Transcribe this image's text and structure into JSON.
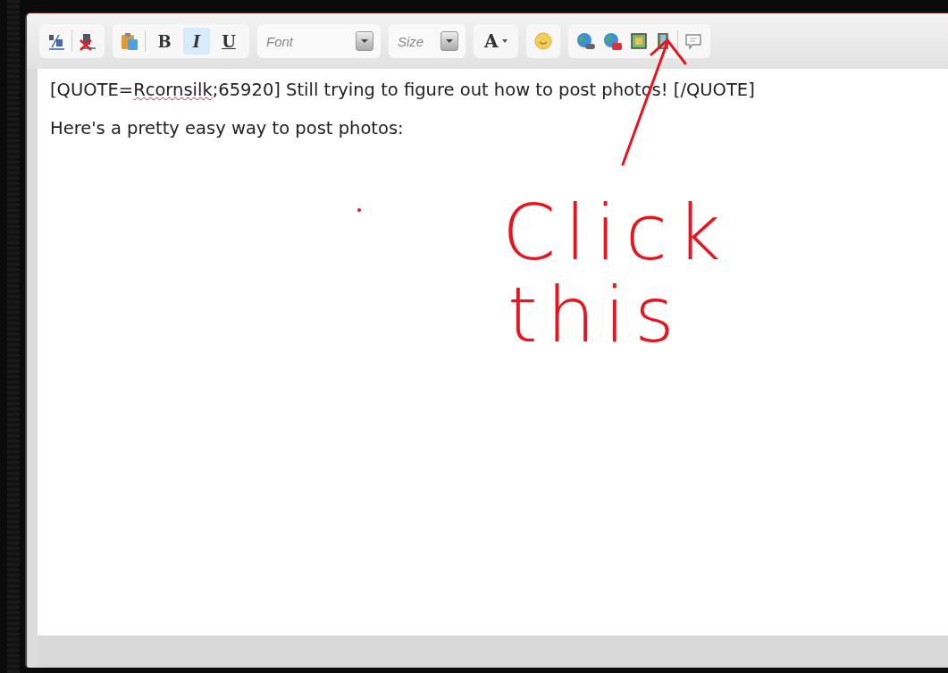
{
  "toolbar": {
    "format_buttons": [
      {
        "label": "B",
        "selected": false
      },
      {
        "label": "I",
        "selected": true
      },
      {
        "label": "U",
        "selected": false
      }
    ],
    "font_select": {
      "placeholder": "Font"
    },
    "size_select": {
      "placeholder": "Size"
    },
    "text_color_button": {
      "label": "A"
    }
  },
  "editor": {
    "paragraphs": [
      [
        {
          "text": "[QUOTE=",
          "misspelled": false
        },
        {
          "text": "Rcornsilk",
          "misspelled": true
        },
        {
          "text": ";65920] Still trying to figure out how to post photos! [/QUOTE]",
          "misspelled": false
        }
      ],
      [
        {
          "text": "Here's a pretty easy way to post photos:",
          "misspelled": false
        }
      ]
    ]
  },
  "annotation": {
    "lines": [
      "Click",
      "this"
    ]
  }
}
